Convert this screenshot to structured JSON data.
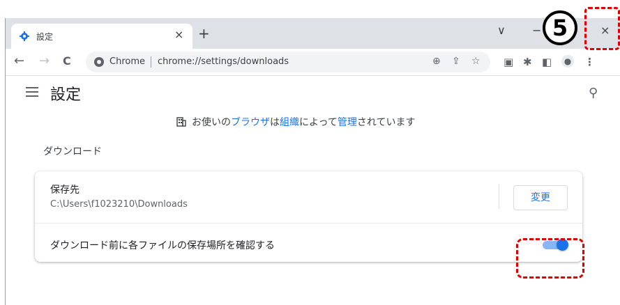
{
  "browser": {
    "tab": {
      "title": "設定",
      "close": "×"
    },
    "new_tab": "+",
    "window_controls": {
      "dropdown": "∨",
      "minimize": "−",
      "close": "×"
    },
    "nav": {
      "back": "←",
      "forward": "→",
      "reload": "C"
    },
    "omnibox": {
      "site_name": "Chrome",
      "url": "chrome://settings/downloads"
    }
  },
  "settings": {
    "page_title": "設定",
    "managed_notice": {
      "prefix": "お使いの",
      "link1": "ブラウザ",
      "middle": "は",
      "link2": "組織",
      "middle2": "によって",
      "link3": "管理",
      "suffix": "されています"
    },
    "section_title": "ダウンロード",
    "location": {
      "label": "保存先",
      "path": "C:\\Users\\f1023210\\Downloads",
      "change_button": "変更"
    },
    "ask_where": {
      "label": "ダウンロード前に各ファイルの保存場所を確認する",
      "enabled": true
    }
  },
  "annotation": {
    "step_number": "5",
    "highlight_color": "#e00000"
  },
  "colors": {
    "accent": "#1a73e8",
    "titlebar": "#dee1e6"
  }
}
